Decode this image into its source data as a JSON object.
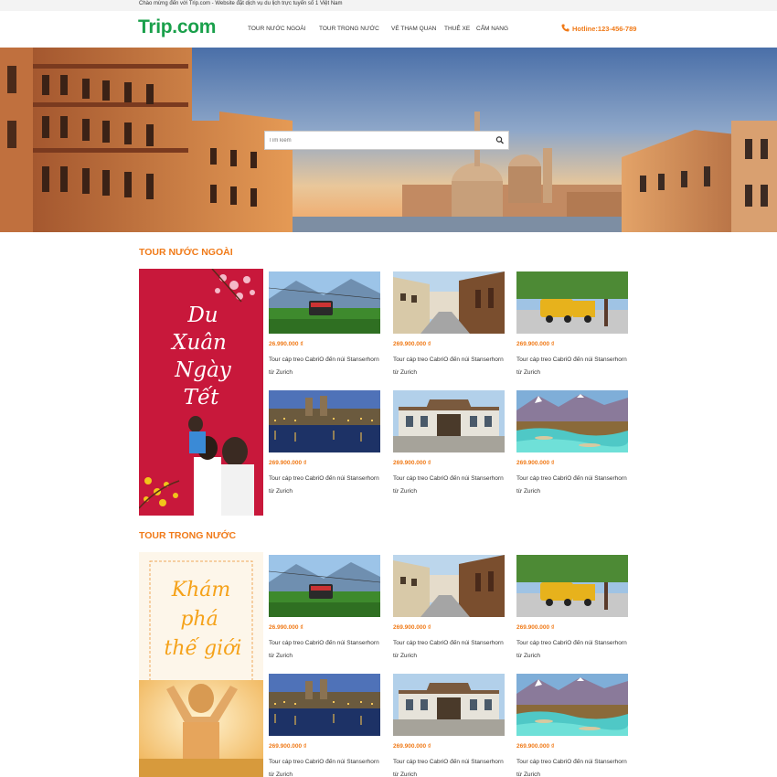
{
  "topbar": {
    "welcome": "Chào mừng đến với Trip.com - Website đặt dịch vụ du lịch trực tuyến số 1 Việt Nam"
  },
  "header": {
    "logo": "Trip.com",
    "nav": [
      "TOUR NƯỚC NGOÀI",
      "TOUR TRONG NƯỚC",
      "VÉ THAM QUAN",
      "THUÊ XE",
      "CẨM NANG"
    ],
    "hotline": "Hotline:123-456-789"
  },
  "search": {
    "placeholder": "Tìm kiếm"
  },
  "sections": [
    {
      "title": "TOUR NƯỚC NGOÀI",
      "promo_text": [
        "Du",
        "Xuân",
        "Ngày",
        "Tết"
      ],
      "cards": [
        {
          "price": "26.990.000 ₫",
          "name": "Tour cáp treo CabriO đến núi Stanserhorn từ Zurich"
        },
        {
          "price": "269.900.000 ₫",
          "name": "Tour cáp treo CabriO đến núi Stanserhorn từ Zurich"
        },
        {
          "price": "269.900.000 ₫",
          "name": "Tour cáp treo CabriO đến núi Stanserhorn từ Zurich"
        },
        {
          "price": "269.900.000 ₫",
          "name": "Tour cáp treo CabriO đến núi Stanserhorn từ Zurich"
        },
        {
          "price": "269.900.000 ₫",
          "name": "Tour cáp treo CabriO đến núi Stanserhorn từ Zurich"
        },
        {
          "price": "269.900.000 ₫",
          "name": "Tour cáp treo CabriO đến núi Stanserhorn từ Zurich"
        }
      ]
    },
    {
      "title": "TOUR TRONG NƯỚC",
      "promo_text": [
        "Khám",
        "phá",
        "thế giới"
      ],
      "cards": [
        {
          "price": "26.990.000 ₫",
          "name": "Tour cáp treo CabriO đến núi Stanserhorn từ Zurich"
        },
        {
          "price": "269.900.000 ₫",
          "name": "Tour cáp treo CabriO đến núi Stanserhorn từ Zurich"
        },
        {
          "price": "269.900.000 ₫",
          "name": "Tour cáp treo CabriO đến núi Stanserhorn từ Zurich"
        },
        {
          "price": "269.900.000 ₫",
          "name": "Tour cáp treo CabriO đến núi Stanserhorn từ Zurich"
        },
        {
          "price": "269.900.000 ₫",
          "name": "Tour cáp treo CabriO đến núi Stanserhorn từ Zurich"
        },
        {
          "price": "269.900.000 ₫",
          "name": "Tour cáp treo CabriO đến núi Stanserhorn từ Zurich"
        }
      ]
    }
  ],
  "colors": {
    "brand_green": "#1aa04b",
    "accent_orange": "#f07a18"
  },
  "icons": {
    "search": "search-icon",
    "phone": "phone-icon"
  }
}
